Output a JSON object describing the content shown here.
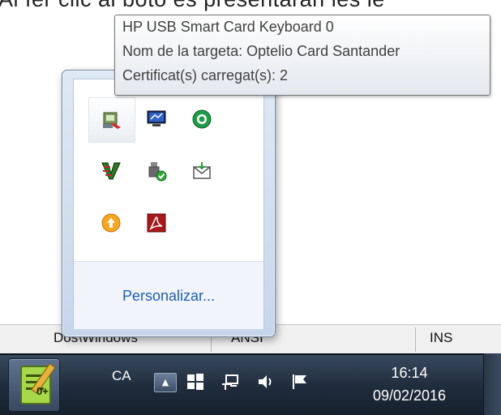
{
  "background_text": "Al fer clic al botó es presentaran les le",
  "tooltip": {
    "line1": "HP USB Smart Card Keyboard 0",
    "line2": "Nom de la targeta: Optelio Card Santander",
    "line3": "Certificat(s) carregat(s): 2"
  },
  "tray_popup": {
    "icons": [
      {
        "name": "smart-card-reader-icon"
      },
      {
        "name": "network-monitor-icon"
      },
      {
        "name": "green-circle-app-icon"
      },
      {
        "name": "v-logo-app-icon"
      },
      {
        "name": "usb-safely-remove-icon"
      },
      {
        "name": "mail-envelope-icon"
      },
      {
        "name": "update-arrow-icon"
      },
      {
        "name": "adobe-acrobat-icon"
      }
    ],
    "customize_label": "Personalizar..."
  },
  "statusbar": {
    "cell1": "Dos\\Windows",
    "cell2": "ANSI",
    "cell3": "INS"
  },
  "taskbar": {
    "app_label": "0+",
    "language": "CA",
    "clock_time": "16:14",
    "clock_date": "09/02/2016"
  },
  "colors": {
    "taskbar": "#1f2c3c",
    "link": "#1e5fb4",
    "popup_border": "#6f85a3"
  }
}
